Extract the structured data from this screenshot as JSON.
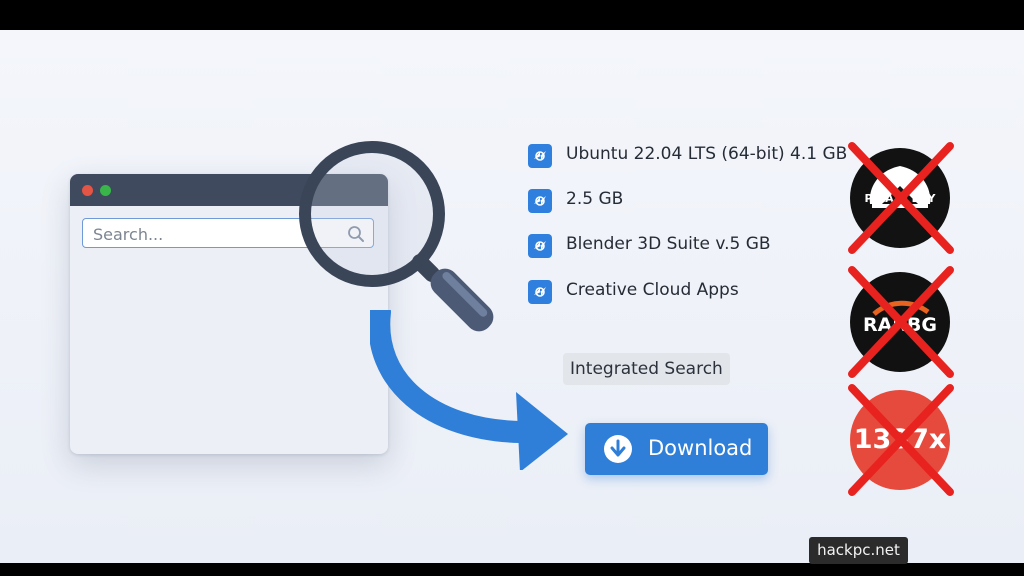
{
  "search": {
    "placeholder": "Search..."
  },
  "results": [
    {
      "label": "Ubuntu 22.04 LTS (64-bit) 4.1 GB",
      "icon": "app-icon"
    },
    {
      "label": "2.5 GB",
      "icon": "app-icon"
    },
    {
      "label": "Blender 3D Suite v.5 GB",
      "icon": "app-icon"
    },
    {
      "label": "Creative Cloud Apps",
      "icon": "app-icon"
    }
  ],
  "tag": {
    "label": "Integrated Search"
  },
  "download": {
    "label": "Download",
    "color": "#2f7fd8"
  },
  "blocked_sites": [
    {
      "name": "piratebay-logo",
      "text": "PIRATE BAY",
      "color": "#121212"
    },
    {
      "name": "rarbg-logo",
      "text": "RARBG",
      "color": "#111111"
    },
    {
      "name": "1337x-logo",
      "text": "1337x",
      "color": "#e64a3c"
    }
  ],
  "watermark": "hackpc.net",
  "colors": {
    "accent": "#2f7fd8",
    "cross": "#e8231f",
    "window_bar": "#3f4a5e"
  }
}
